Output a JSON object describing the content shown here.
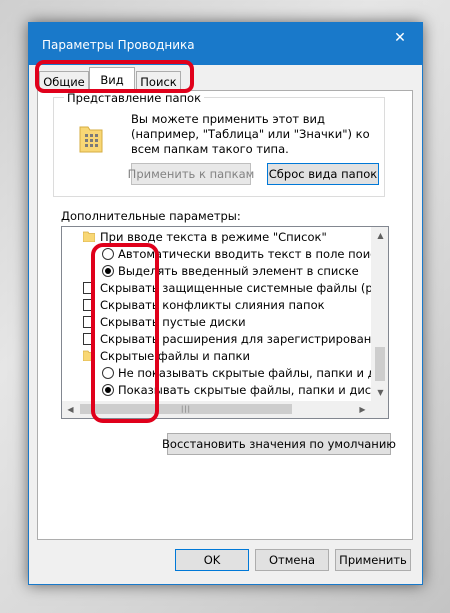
{
  "window": {
    "title": "Параметры Проводника",
    "close_glyph": "✕"
  },
  "tabs": [
    {
      "label": "Общие"
    },
    {
      "label": "Вид"
    },
    {
      "label": "Поиск"
    }
  ],
  "folder_view": {
    "legend": "Представление папок",
    "description": "Вы можете применить этот вид (например, \"Таблица\" или \"Значки\") ко всем папкам такого типа.",
    "apply_button": "Применить к папкам",
    "reset_button": "Сброс вида папок"
  },
  "advanced": {
    "label": "Дополнительные параметры:",
    "items": [
      {
        "type": "folder",
        "text": "При вводе текста в режиме \"Список\""
      },
      {
        "type": "radio",
        "checked": false,
        "text": "Автоматически вводить текст в поле поиска"
      },
      {
        "type": "radio",
        "checked": true,
        "text": "Выделять введенный элемент в списке"
      },
      {
        "type": "checkbox",
        "checked": false,
        "text": "Скрывать защищенные системные файлы (рекомен"
      },
      {
        "type": "checkbox",
        "checked": false,
        "text": "Скрывать конфликты слияния папок"
      },
      {
        "type": "checkbox",
        "checked": false,
        "text": "Скрывать пустые диски"
      },
      {
        "type": "checkbox",
        "checked": false,
        "text": "Скрывать расширения для зарегистрированных типо"
      },
      {
        "type": "folder",
        "text": "Скрытые файлы и папки"
      },
      {
        "type": "radio",
        "checked": false,
        "text": "Не показывать скрытые файлы, папки и диски"
      },
      {
        "type": "radio",
        "checked": true,
        "text": "Показывать скрытые файлы, папки и диски"
      }
    ]
  },
  "restore_button": "Восстановить значения по умолчанию",
  "footer": {
    "ok": "OK",
    "cancel": "Отмена",
    "apply": "Применить"
  },
  "colors": {
    "titlebar": "#1979ca",
    "highlight": "#e0001b",
    "folder": "#f8d775"
  }
}
